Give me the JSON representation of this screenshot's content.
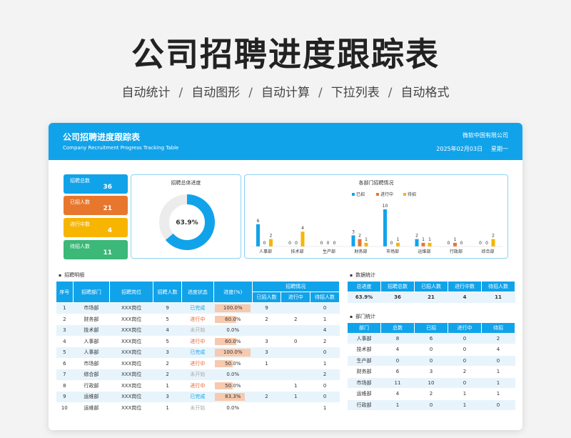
{
  "hero": {
    "title": "公司招聘进度跟踪表",
    "features": [
      "自动统计",
      "自动图形",
      "自动计算",
      "下拉列表",
      "自动格式"
    ],
    "separator": "/"
  },
  "header": {
    "title": "公司招聘进度跟踪表",
    "subtitle": "Company Recruitment Progress Tracking Table",
    "company": "微软中国有限公司",
    "date": "2025年02月03日",
    "weekday": "星期一"
  },
  "kpis": [
    {
      "label": "招聘总数",
      "value": "36",
      "color": "#11a3ea"
    },
    {
      "label": "已招人数",
      "value": "21",
      "color": "#e8772e"
    },
    {
      "label": "进行中数",
      "value": "4",
      "color": "#f7b500"
    },
    {
      "label": "待招人数",
      "value": "11",
      "color": "#3cb878"
    }
  ],
  "donut": {
    "title": "招聘总体进度",
    "label": "63.9%",
    "value": 0.639,
    "color": "#11a3ea",
    "track": "#ececec"
  },
  "chart_data": {
    "type": "bar",
    "title": "各部门招聘情况",
    "categories": [
      "人事部",
      "技术部",
      "生产部",
      "财务部",
      "市场部",
      "运维部",
      "行政部",
      "综合部"
    ],
    "series": [
      {
        "name": "已招",
        "color": "#11a3ea",
        "values": [
          6,
          0,
          0,
          3,
          10,
          2,
          0,
          0
        ]
      },
      {
        "name": "进行中",
        "color": "#e8772e",
        "values": [
          0,
          0,
          0,
          2,
          0,
          1,
          1,
          0
        ]
      },
      {
        "name": "待招",
        "color": "#f7b500",
        "values": [
          2,
          4,
          0,
          1,
          1,
          1,
          0,
          2
        ]
      }
    ],
    "ylim": [
      0,
      10
    ],
    "legend": "top"
  },
  "detail": {
    "title": "招聘明细",
    "headers": [
      "序号",
      "招聘部门",
      "招聘岗位",
      "招聘人数",
      "进度状态",
      "进度(%)"
    ],
    "group_header": "招聘情况",
    "sub_headers": [
      "已招人数",
      "进行中",
      "待招人数"
    ],
    "rows": [
      {
        "no": "1",
        "dept": "市场部",
        "pos": "XXX岗位",
        "num": "9",
        "status": "已完成",
        "st": "done",
        "pct": "100.0%",
        "p": 1.0,
        "hired": "9",
        "prog": "",
        "wait": "0"
      },
      {
        "no": "2",
        "dept": "财务部",
        "pos": "XXX岗位",
        "num": "5",
        "status": "进行中",
        "st": "prog",
        "pct": "60.0%",
        "p": 0.6,
        "hired": "2",
        "prog": "2",
        "wait": "1"
      },
      {
        "no": "3",
        "dept": "技术部",
        "pos": "XXX岗位",
        "num": "4",
        "status": "未开始",
        "st": "none",
        "pct": "0.0%",
        "p": 0,
        "hired": "",
        "prog": "",
        "wait": "4"
      },
      {
        "no": "4",
        "dept": "人事部",
        "pos": "XXX岗位",
        "num": "5",
        "status": "进行中",
        "st": "prog",
        "pct": "60.0%",
        "p": 0.6,
        "hired": "3",
        "prog": "0",
        "wait": "2"
      },
      {
        "no": "5",
        "dept": "人事部",
        "pos": "XXX岗位",
        "num": "3",
        "status": "已完成",
        "st": "done",
        "pct": "100.0%",
        "p": 1.0,
        "hired": "3",
        "prog": "",
        "wait": "0"
      },
      {
        "no": "6",
        "dept": "市场部",
        "pos": "XXX岗位",
        "num": "2",
        "status": "进行中",
        "st": "prog",
        "pct": "50.0%",
        "p": 0.5,
        "hired": "1",
        "prog": "",
        "wait": "1"
      },
      {
        "no": "7",
        "dept": "综合部",
        "pos": "XXX岗位",
        "num": "2",
        "status": "未开始",
        "st": "none",
        "pct": "0.0%",
        "p": 0,
        "hired": "",
        "prog": "",
        "wait": "2"
      },
      {
        "no": "8",
        "dept": "行政部",
        "pos": "XXX岗位",
        "num": "1",
        "status": "进行中",
        "st": "prog",
        "pct": "50.0%",
        "p": 0.5,
        "hired": "",
        "prog": "1",
        "wait": "0"
      },
      {
        "no": "9",
        "dept": "运维部",
        "pos": "XXX岗位",
        "num": "3",
        "status": "已完成",
        "st": "done",
        "pct": "83.3%",
        "p": 0.833,
        "hired": "2",
        "prog": "1",
        "wait": "0"
      },
      {
        "no": "10",
        "dept": "运维部",
        "pos": "XXX岗位",
        "num": "1",
        "status": "未开始",
        "st": "none",
        "pct": "0.0%",
        "p": 0,
        "hired": "",
        "prog": "",
        "wait": "1"
      }
    ]
  },
  "stats": {
    "title": "数据统计",
    "headers": [
      "总进度",
      "招聘总数",
      "已招人数",
      "进行中数",
      "待招人数"
    ],
    "values": [
      "63.9%",
      "36",
      "21",
      "4",
      "11"
    ]
  },
  "dept_stats": {
    "title": "部门统计",
    "headers": [
      "部门",
      "总数",
      "已招",
      "进行中",
      "待招"
    ],
    "rows": [
      [
        "人事部",
        "8",
        "6",
        "0",
        "2"
      ],
      [
        "技术部",
        "4",
        "0",
        "0",
        "4"
      ],
      [
        "生产部",
        "0",
        "0",
        "0",
        "0"
      ],
      [
        "财务部",
        "6",
        "3",
        "2",
        "1"
      ],
      [
        "市场部",
        "11",
        "10",
        "0",
        "1"
      ],
      [
        "运维部",
        "4",
        "2",
        "1",
        "1"
      ],
      [
        "行政部",
        "1",
        "0",
        "1",
        "0"
      ]
    ]
  }
}
